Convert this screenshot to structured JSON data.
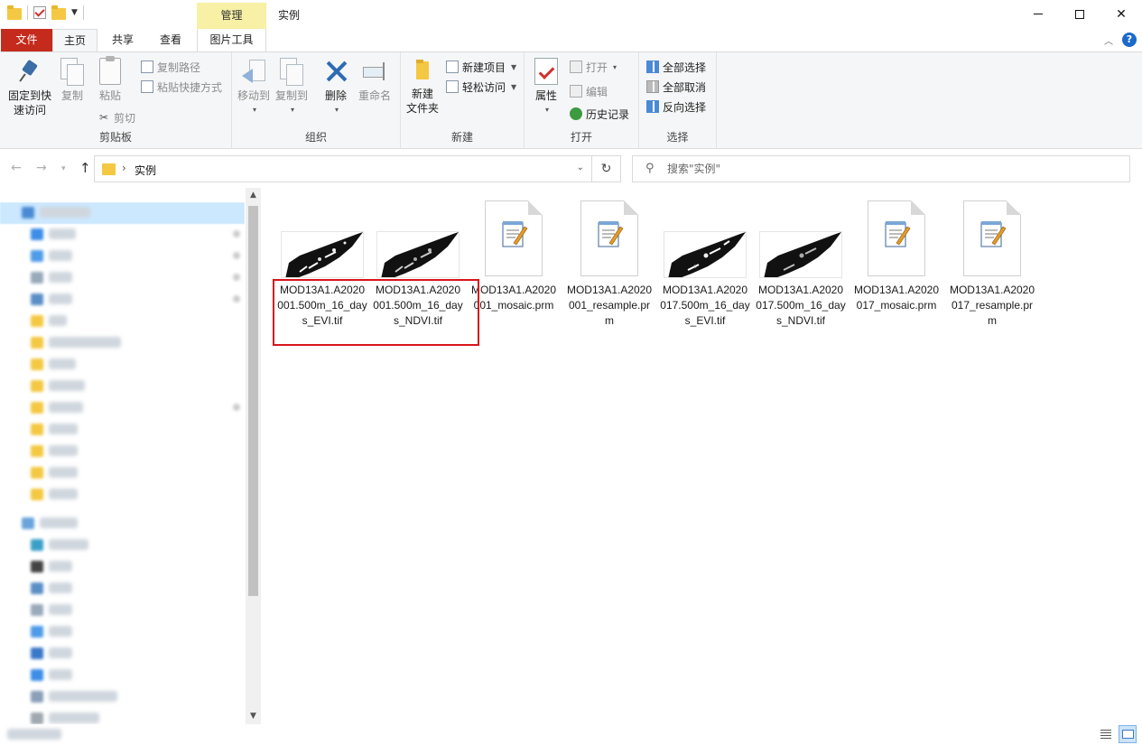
{
  "window": {
    "title": "实例",
    "context_tab_header": "管理"
  },
  "ribbon": {
    "tabs": [
      {
        "label": "文件"
      },
      {
        "label": "主页"
      },
      {
        "label": "共享"
      },
      {
        "label": "查看"
      },
      {
        "label": "图片工具"
      }
    ],
    "active_tab": "主页",
    "clipboard": {
      "label": "剪贴板",
      "pin_line1": "固定到快",
      "pin_line2": "速访问",
      "copy": "复制",
      "paste": "粘贴",
      "copy_path": "复制路径",
      "paste_shortcut": "粘贴快捷方式",
      "cut": "剪切"
    },
    "organize": {
      "label": "组织",
      "move_to": "移动到",
      "copy_to": "复制到",
      "delete": "删除",
      "rename": "重命名"
    },
    "new": {
      "label": "新建",
      "new_folder_line1": "新建",
      "new_folder_line2": "文件夹",
      "new_item": "新建项目",
      "easy_access": "轻松访问"
    },
    "open": {
      "label": "打开",
      "properties": "属性",
      "open": "打开",
      "edit": "编辑",
      "history": "历史记录"
    },
    "select": {
      "label": "选择",
      "select_all": "全部选择",
      "select_none": "全部取消",
      "invert": "反向选择"
    }
  },
  "address": {
    "path": "实例",
    "search_placeholder": "搜索\"实例\""
  },
  "files": [
    {
      "name": "MOD13A1.A2020001.500m_16_days_EVI.tif",
      "type": "tif",
      "icon": "tif-image-thumbnail"
    },
    {
      "name": "MOD13A1.A2020001.500m_16_days_NDVI.tif",
      "type": "tif",
      "icon": "tif-image-thumbnail"
    },
    {
      "name": "MOD13A1.A2020001_mosaic.prm",
      "type": "prm",
      "icon": "notepad-document-icon"
    },
    {
      "name": "MOD13A1.A2020001_resample.prm",
      "type": "prm",
      "icon": "notepad-document-icon"
    },
    {
      "name": "MOD13A1.A2020017.500m_16_days_EVI.tif",
      "type": "tif",
      "icon": "tif-image-thumbnail"
    },
    {
      "name": "MOD13A1.A2020017.500m_16_days_NDVI.tif",
      "type": "tif",
      "icon": "tif-image-thumbnail"
    },
    {
      "name": "MOD13A1.A2020017_mosaic.prm",
      "type": "prm",
      "icon": "notepad-document-icon"
    },
    {
      "name": "MOD13A1.A2020017_resample.prm",
      "type": "prm",
      "icon": "notepad-document-icon"
    }
  ],
  "colors": {
    "file_tab": "#c42b1c",
    "context_tab": "#f7f0a5",
    "highlight": "#d9141b",
    "selection": "#cce8ff"
  }
}
